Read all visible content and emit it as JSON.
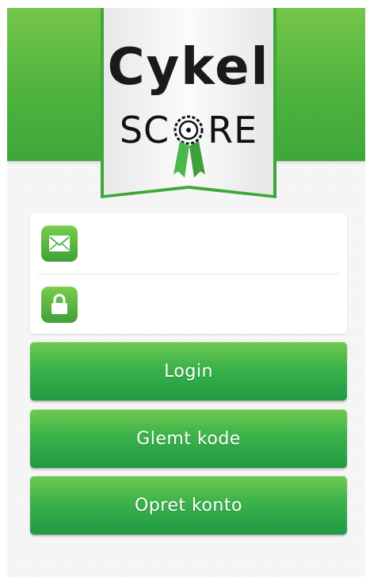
{
  "app": {
    "logo_top": "Cykel",
    "logo_bottom_left": "SC",
    "logo_bottom_right": "RE"
  },
  "colors": {
    "brand_green": "#4fb33e",
    "button_green": "#3bb24a",
    "background": "#f2f2f2"
  },
  "form": {
    "email": {
      "icon": "envelope-icon",
      "value": "",
      "placeholder": ""
    },
    "password": {
      "icon": "lock-icon",
      "value": "",
      "placeholder": ""
    }
  },
  "buttons": {
    "login": "Login",
    "forgot": "Glemt kode",
    "create": "Opret konto"
  }
}
